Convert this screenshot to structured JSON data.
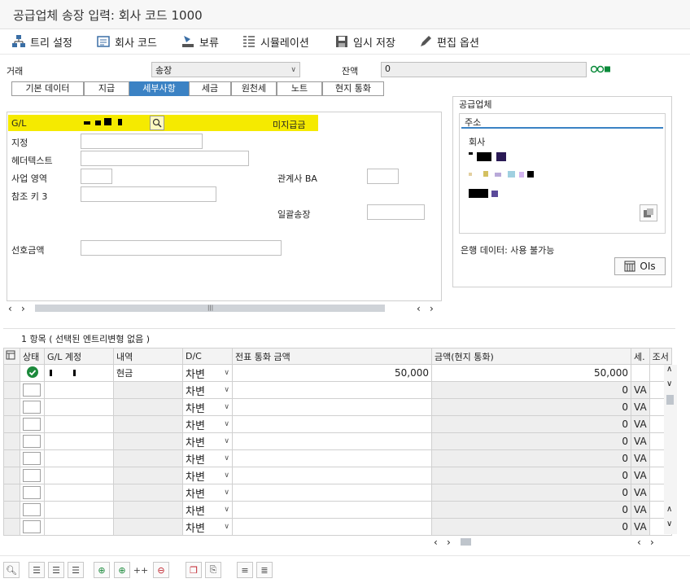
{
  "window": {
    "title": "공급업체 송장 입력: 회사 코드 1000"
  },
  "toolbar": {
    "tree": "트리 설정",
    "company_code": "회사 코드",
    "hold": "보류",
    "simulation": "시뮬레이션",
    "park": "임시 저장",
    "editing_options": "편집 옵션"
  },
  "header": {
    "transaction_label": "거래",
    "transaction_value": "송장",
    "balance_label": "잔액",
    "balance_value": "0"
  },
  "tabs": [
    "기본 데이터",
    "지급",
    "세부사항",
    "세금",
    "원천세",
    "노트",
    "현지 통화"
  ],
  "active_tab": "세부사항",
  "details": {
    "gl_label": "G/L",
    "gl_desc": "미지급금",
    "assignment_label": "지정",
    "header_text_label": "헤더텍스트",
    "business_area_label": "사업 영역",
    "trading_partner_label": "관계사 BA",
    "reference_key_label": "참조 키 3",
    "invoice_label": "일괄송장",
    "preferred_amount_label": "선호금액"
  },
  "vendor": {
    "title": "공급업체",
    "address_tab": "주소",
    "company_label": "회사",
    "bank_data": "은행 데이터: 사용 불가능",
    "ois_button": "OIs"
  },
  "items": {
    "count_text": "1 항목 ( 선택된 엔트리변형 없음 )",
    "columns": [
      "상태",
      "G/L 계정",
      "내역",
      "D/C",
      "전표 통화 금액",
      "금액(현지 통화)",
      "세.",
      "조서"
    ],
    "first_row": {
      "text": "현금",
      "dc": "차변",
      "doc_amount": "50,000",
      "local_amount": "50,000"
    },
    "empty_dc": "차변",
    "empty_local_amount": "0",
    "empty_tax": "VA"
  }
}
